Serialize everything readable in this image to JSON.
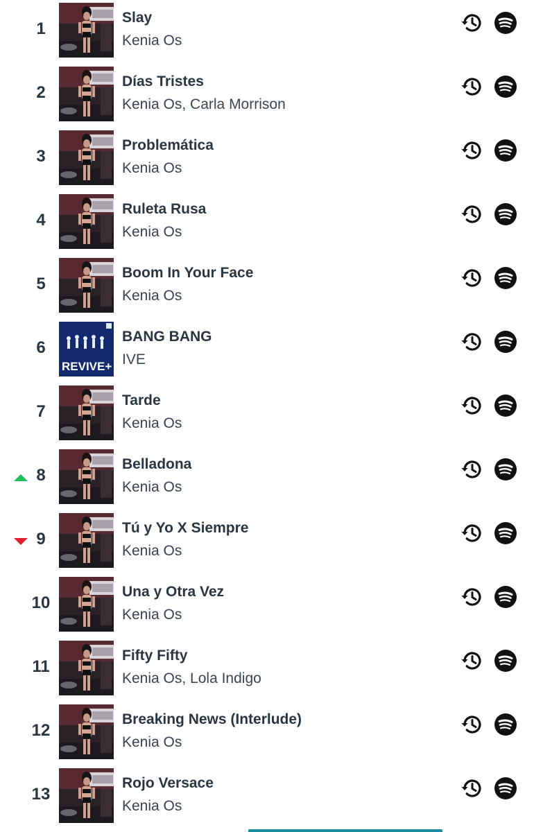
{
  "chart": {
    "tracks": [
      {
        "rank": "1",
        "title": "Slay",
        "artist": "Kenia Os",
        "trend": "",
        "cover": "kenia"
      },
      {
        "rank": "2",
        "title": "Días Tristes",
        "artist": "Kenia Os, Carla Morrison",
        "trend": "",
        "cover": "kenia"
      },
      {
        "rank": "3",
        "title": "Problemática",
        "artist": "Kenia Os",
        "trend": "",
        "cover": "kenia"
      },
      {
        "rank": "4",
        "title": "Ruleta Rusa",
        "artist": "Kenia Os",
        "trend": "",
        "cover": "kenia"
      },
      {
        "rank": "5",
        "title": "Boom In Your Face",
        "artist": "Kenia Os",
        "trend": "",
        "cover": "kenia"
      },
      {
        "rank": "6",
        "title": "BANG BANG",
        "artist": "IVE",
        "trend": "",
        "cover": "ive",
        "cover_text": "REVIVE+"
      },
      {
        "rank": "7",
        "title": "Tarde",
        "artist": "Kenia Os",
        "trend": "",
        "cover": "kenia"
      },
      {
        "rank": "8",
        "title": "Belladona",
        "artist": "Kenia Os",
        "trend": "up",
        "cover": "kenia"
      },
      {
        "rank": "9",
        "title": "Tú y Yo X Siempre",
        "artist": "Kenia Os",
        "trend": "down",
        "cover": "kenia"
      },
      {
        "rank": "10",
        "title": "Una y Otra Vez",
        "artist": "Kenia Os",
        "trend": "",
        "cover": "kenia"
      },
      {
        "rank": "11",
        "title": "Fifty Fifty",
        "artist": "Kenia Os, Lola Indigo",
        "trend": "",
        "cover": "kenia"
      },
      {
        "rank": "12",
        "title": "Breaking News (Interlude)",
        "artist": "Kenia Os",
        "trend": "",
        "cover": "kenia"
      },
      {
        "rank": "13",
        "title": "Rojo Versace",
        "artist": "Kenia Os",
        "trend": "",
        "cover": "kenia"
      }
    ]
  },
  "icons": {
    "history": "history-icon",
    "spotify": "spotify-icon"
  },
  "colors": {
    "text": "#2a3542",
    "trend_up": "#1fbf5a",
    "trend_down": "#e0202e",
    "icon": "#111111",
    "accent_bar": "#1e8aa0"
  }
}
